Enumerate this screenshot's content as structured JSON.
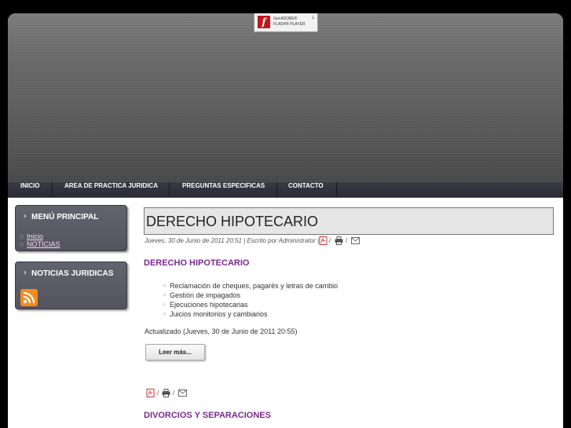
{
  "flash_badge": {
    "line1": "Get ADOBE®",
    "line2": "FLASH® PLAYER"
  },
  "nav": {
    "items": [
      "INICIO",
      "AREA DE PRACTICA JURIDICA",
      "PREGUNTAS ESPECIFICAS",
      "CONTACTO"
    ]
  },
  "sidebar": {
    "main_menu_title": "MENÚ PRINCIPAL",
    "main_menu_links": [
      "Inicio",
      "NOTICIAS"
    ],
    "news_title": "NOTICIAS JURIDICAS",
    "rss_icon": "rss-icon"
  },
  "article": {
    "title": "DERECHO HIPOTECARIO",
    "meta": "Jueves, 30 de Junio de 2011 20:51 | Escrito por Administrator |",
    "subtitle": "DERECHO HIPOTECARIO",
    "items": [
      "Reclamación de cheques, pagarés y letras de cambio",
      "Gestión de impagados",
      "Ejecuciones hipotecarias",
      "Juicios monitorios y cambiarios"
    ],
    "updated": "Actualizado (Jueves, 30 de Junio de 2011 20:55)",
    "read_more": "Leer más...",
    "icon_sep": "/"
  },
  "next_article": {
    "subtitle": "DIVORCIOS Y SEPARACIONES"
  },
  "colors": {
    "accent": "#7a2b8f",
    "nav_bg": "#2e2e37",
    "background": "#000000"
  },
  "icons": [
    "pdf-icon",
    "print-icon",
    "email-icon",
    "rss-icon",
    "chevron-right-icon",
    "flash-logo-icon"
  ]
}
